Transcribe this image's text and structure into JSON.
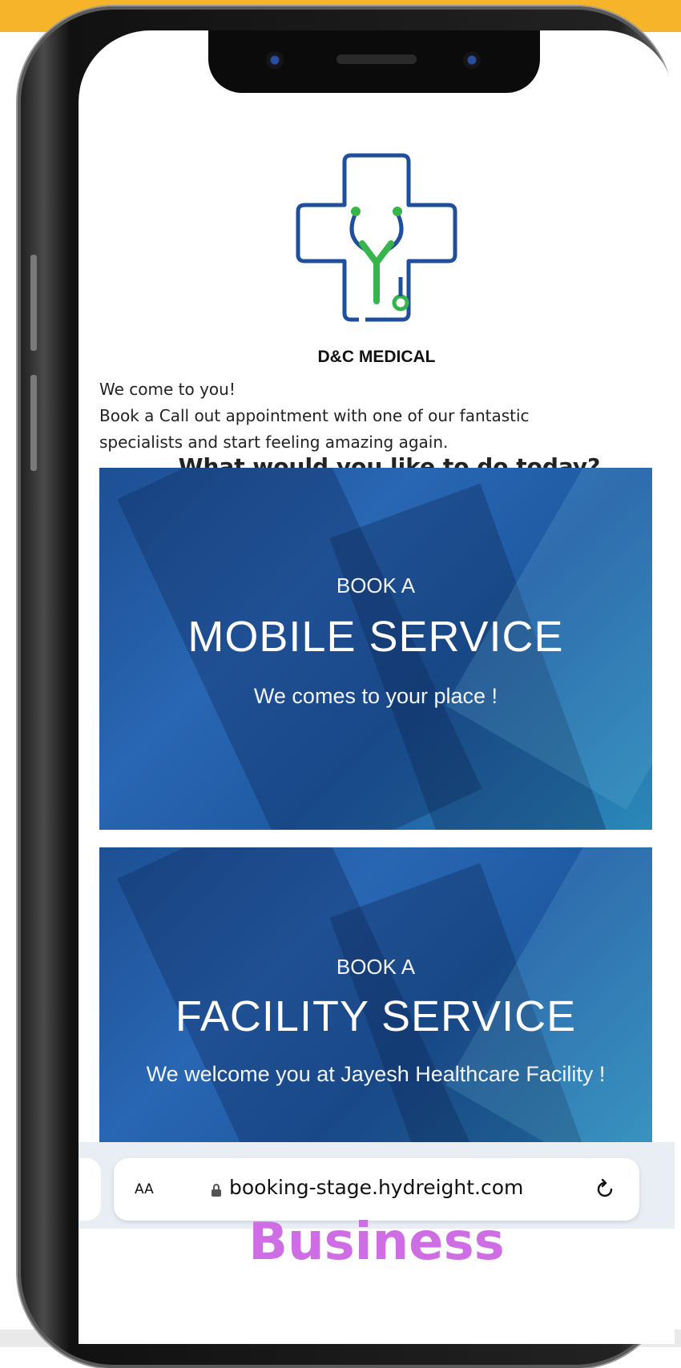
{
  "brand": {
    "name": "D&C MEDICAL"
  },
  "intro": {
    "line1": "We come to you!",
    "line2": "Book a Call out appointment with one of our fantastic specialists and start feeling amazing again."
  },
  "question": "What would you like to do today?",
  "cards": [
    {
      "kicker": "BOOK A",
      "title": "MOBILE SERVICE",
      "subtitle": "We comes to your place !"
    },
    {
      "kicker": "BOOK A",
      "title": "FACILITY SERVICE",
      "subtitle": "We welcome you at Jayesh Healthcare Facility !"
    }
  ],
  "browser": {
    "text_size_label": "AA",
    "url": "booking-stage.hydreight.com"
  },
  "footer_label": "Business",
  "colors": {
    "accent_band": "#f5b42a",
    "card_blue": "#2966b3",
    "footer_purple": "#cf6de4",
    "logo_blue": "#1f4f9c",
    "logo_green": "#35b54a"
  }
}
